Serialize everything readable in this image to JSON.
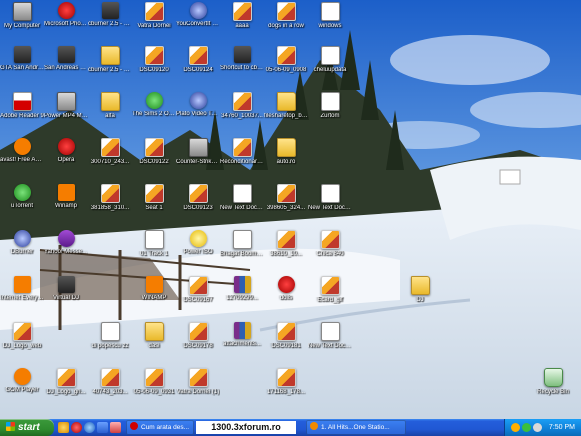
{
  "desktop_icons": [
    {
      "label": "My Computer",
      "glyph": "computer-icon"
    },
    {
      "label": "Microsoft Photo Editor",
      "glyph": "photo-editor-icon"
    },
    {
      "label": "cburner 2.5 - by Tomay",
      "glyph": "winamp-icon"
    },
    {
      "label": "Vatra Dornei",
      "glyph": "image-file-icon"
    },
    {
      "label": "YouConvertIt Classic",
      "glyph": "convert-icon"
    },
    {
      "label": "aaaa",
      "glyph": "image-file-icon"
    },
    {
      "label": "dogs in a row",
      "glyph": "image-file-icon"
    },
    {
      "label": "windows",
      "glyph": "document-icon"
    },
    {
      "label": "GTA San Andreas",
      "glyph": "game-icon"
    },
    {
      "label": "San Andreas Mod Installer",
      "glyph": "game-icon"
    },
    {
      "label": "cburner 2.5 - by Tomay",
      "glyph": "folder-icon"
    },
    {
      "label": "DSC09120",
      "glyph": "image-file-icon"
    },
    {
      "label": "DSC09124",
      "glyph": "image-file-icon"
    },
    {
      "label": "Shortcut to cburner",
      "glyph": "game-icon"
    },
    {
      "label": "05-06-09_0908",
      "glyph": "image-file-icon"
    },
    {
      "label": "cheluupdata",
      "glyph": "document-icon"
    },
    {
      "label": "Adobe Reader 9",
      "glyph": "pdf-icon"
    },
    {
      "label": "Power MP4 MOV VCD W...",
      "glyph": "media-icon"
    },
    {
      "label": "alfa",
      "glyph": "folder-icon"
    },
    {
      "label": "The Sims 2 Open For...",
      "glyph": "sims-icon"
    },
    {
      "label": "Plato Video To DVD Converter",
      "glyph": "dvd-icon"
    },
    {
      "label": "34760_10037...",
      "glyph": "image-file-icon"
    },
    {
      "label": "filesharetop_bi Bud-Eth - 12...",
      "glyph": "folder-icon"
    },
    {
      "label": "Zurtom",
      "glyph": "document-icon"
    },
    {
      "label": "avast! Free Antivirus",
      "glyph": "avast-icon"
    },
    {
      "label": "Opera",
      "glyph": "opera-icon"
    },
    {
      "label": "300710_243...",
      "glyph": "image-file-icon"
    },
    {
      "label": "DSC09122",
      "glyph": "image-file-icon"
    },
    {
      "label": "Counter-Strike 1.6 v40",
      "glyph": "cs-icon"
    },
    {
      "label": "Reconditionare 1300",
      "glyph": "image-file-icon"
    },
    {
      "label": "auto.ro",
      "glyph": "folder-icon"
    },
    {
      "label": "",
      "glyph": "none"
    },
    {
      "label": "uTorrent",
      "glyph": "utorrent-icon"
    },
    {
      "label": "Winamp",
      "glyph": "winamp-icon"
    },
    {
      "label": "381858_310...",
      "glyph": "image-file-icon"
    },
    {
      "label": "Seat 1",
      "glyph": "image-file-icon"
    },
    {
      "label": "DSC09123",
      "glyph": "image-file-icon"
    },
    {
      "label": "New Text Document",
      "glyph": "document-icon"
    },
    {
      "label": "398605_324...",
      "glyph": "image-file-icon"
    },
    {
      "label": "New Text Document (4)",
      "glyph": "document-icon"
    },
    {
      "label": "DBurner",
      "glyph": "dvd-icon"
    },
    {
      "label": "Yahoo! Messenger",
      "glyph": "yahoo-icon"
    },
    {
      "label": "",
      "glyph": "none"
    },
    {
      "label": "01 Track 1",
      "glyph": "document-icon"
    },
    {
      "label": "Power ISO",
      "glyph": "poweriso-icon"
    },
    {
      "label": "Bhagat Boombang",
      "glyph": "document-icon"
    },
    {
      "label": "38610_10...",
      "glyph": "image-file-icon"
    },
    {
      "label": "Chica 840",
      "glyph": "image-file-icon"
    },
    {
      "label": "Internet Everywhere",
      "glyph": "orange-icon"
    },
    {
      "label": "Virtual DJ",
      "glyph": "virtualdj-icon"
    },
    {
      "label": "WINAMP",
      "glyph": "winamp-icon"
    },
    {
      "label": "DSC09167",
      "glyph": "image-file-icon"
    },
    {
      "label": "12709299...",
      "glyph": "rar-icon"
    },
    {
      "label": "dolls",
      "glyph": "red-icon"
    },
    {
      "label": "Ecard_gif",
      "glyph": "image-file-icon"
    },
    {
      "label": "DJ",
      "glyph": "folder-icon"
    },
    {
      "label": "DJ_Logo_web",
      "glyph": "image-file-icon"
    },
    {
      "label": "di popescu zz",
      "glyph": "document-icon"
    },
    {
      "label": "dasi",
      "glyph": "folder-icon"
    },
    {
      "label": "DSC09178",
      "glyph": "image-file-icon"
    },
    {
      "label": "attachments...",
      "glyph": "rar-icon"
    },
    {
      "label": "DSC09181",
      "glyph": "image-file-icon"
    },
    {
      "label": "New Text Document (2)",
      "glyph": "document-icon"
    },
    {
      "label": "GOM Player",
      "glyph": "gom-icon"
    },
    {
      "label": "DJ_Logo_gri...",
      "glyph": "image-file-icon"
    },
    {
      "label": "40743_203...",
      "glyph": "image-file-icon"
    },
    {
      "label": "05-06-09_0931",
      "glyph": "image-file-icon"
    },
    {
      "label": "Vatra Dornei (1)",
      "glyph": "image-file-icon"
    },
    {
      "label": "171168_178...",
      "glyph": "image-file-icon"
    },
    {
      "label": "Recycle Bin",
      "glyph": "recycle-bin-icon"
    }
  ],
  "taskbar": {
    "start_label": "start",
    "tasks": [
      {
        "label": "Cum arata des...",
        "icon": "opera-icon"
      },
      {
        "label": "1. All Hits...One Statio...",
        "icon": "winamp-icon"
      }
    ],
    "clock": "7:50 PM"
  },
  "watermark": "1300.3xforum.ro",
  "colors": {
    "taskbar": "#245edb",
    "start": "#2e8b2e",
    "tray": "#0f7fd6"
  }
}
